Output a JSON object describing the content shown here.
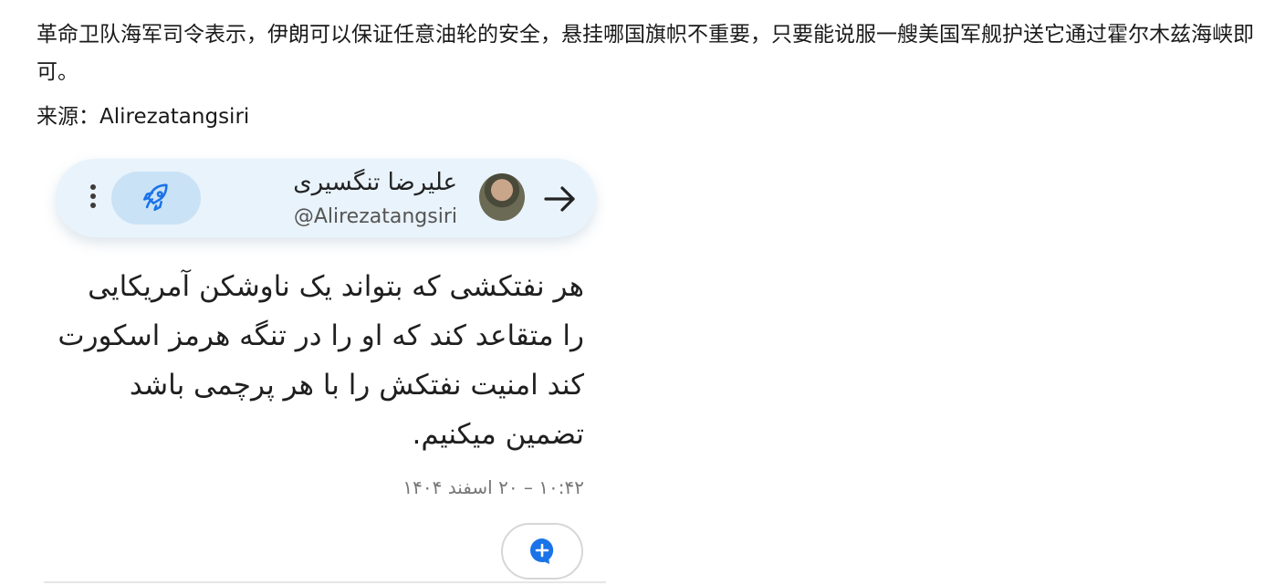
{
  "post": {
    "text": "革命卫队海军司令表示，伊朗可以保证任意油轮的安全，悬挂哪国旗帜不重要，只要能说服一艘美国军舰护送它通过霍尔木兹海峡即可。",
    "source": "来源：Alirezatangsiri"
  },
  "screenshot": {
    "header": {
      "display_name": "علیرضا تنگسیری",
      "handle": "@Alirezatangsiri",
      "menu_icon": "kebab-menu-icon",
      "rocket_icon": "rocket-icon",
      "arrow_icon": "arrow-right-icon"
    },
    "tweet_lines": [
      "هر نفتکشی که بتواند یک ناوشکن آمریکایی",
      "را متقاعد کند که او را در تنگه هرمز اسکورت",
      "کند امنیت نفتکش  را با هر پرچمی باشد",
      "تضمین میکنیم."
    ],
    "timestamp": "۱۰:۴۲ – ۲۰ اسفند ۱۴۰۴",
    "reply_icon": "add-comment-icon",
    "colors": {
      "header_bg": "#e9f3fb",
      "rocket_btn_bg": "#c9e2f6",
      "accent_blue": "#1a73e8"
    }
  }
}
